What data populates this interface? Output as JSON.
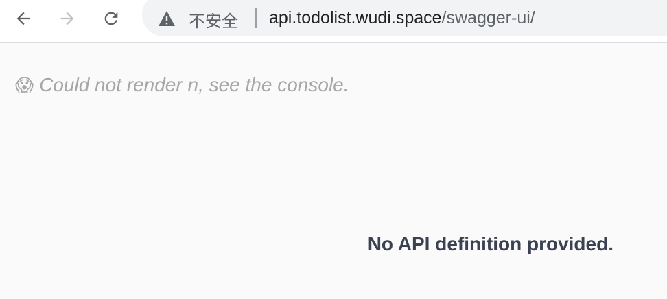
{
  "browser": {
    "back_icon": "arrow-left-icon",
    "forward_icon": "arrow-right-icon",
    "reload_icon": "reload-icon",
    "security_icon": "warning-triangle-icon",
    "security_label": "不安全",
    "url_host": "api.todolist.wudi.space",
    "url_path": "/swagger-ui/"
  },
  "page": {
    "error_emoji": "😱",
    "error_message": "Could not render n, see the console.",
    "no_api_message": "No API definition provided."
  },
  "colors": {
    "error_text": "#a6a6a6",
    "heading_text": "#3b4151",
    "background": "#fafafa"
  }
}
